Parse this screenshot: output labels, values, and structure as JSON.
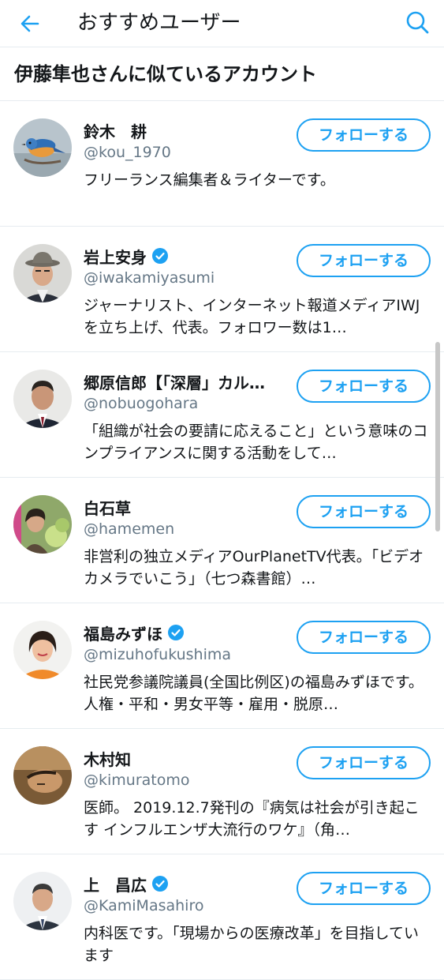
{
  "header": {
    "title": "おすすめユーザー",
    "back_icon": "arrow-left-icon",
    "search_icon": "search-icon"
  },
  "section": {
    "title": "伊藤隼也さんに似ているアカウント"
  },
  "colors": {
    "accent": "#1da1f2",
    "text": "#14171a",
    "secondary_text": "#657786",
    "divider": "#e6ecf0"
  },
  "follow_label": "フォローする",
  "users": [
    {
      "name": "鈴木　耕",
      "handle": "@kou_1970",
      "verified": false,
      "bio": "フリーランス編集者＆ライターです。"
    },
    {
      "name": "岩上安身",
      "handle": "@iwakamiyasumi",
      "verified": true,
      "bio": "ジャーナリスト、インターネット報道メディアIWJを立ち上げ、代表。フォロワー数は1…"
    },
    {
      "name": "郷原信郎【「深層」カル…",
      "handle": "@nobuogohara",
      "verified": false,
      "bio": "「組織が社会の要請に応えること」という意味のコンプライアンスに関する活動をして…"
    },
    {
      "name": "白石草",
      "handle": "@hamemen",
      "verified": false,
      "bio": "非営利の独立メディアOurPlanetTV代表。「ビデオカメラでいこう」（七つ森書館）…"
    },
    {
      "name": "福島みずほ",
      "handle": "@mizuhofukushima",
      "verified": true,
      "bio": "社民党参議院議員(全国比例区)の福島みずほです。人権・平和・男女平等・雇用・脱原…"
    },
    {
      "name": "木村知",
      "handle": "@kimuratomo",
      "verified": false,
      "bio": "医師。 2019.12.7発刊の『病気は社会が引き起こす インフルエンザ大流行のワケ』（角…"
    },
    {
      "name": "上　昌広",
      "handle": "@KamiMasahiro",
      "verified": true,
      "bio": "内科医です。「現場からの医療改革」を目指しています"
    }
  ]
}
